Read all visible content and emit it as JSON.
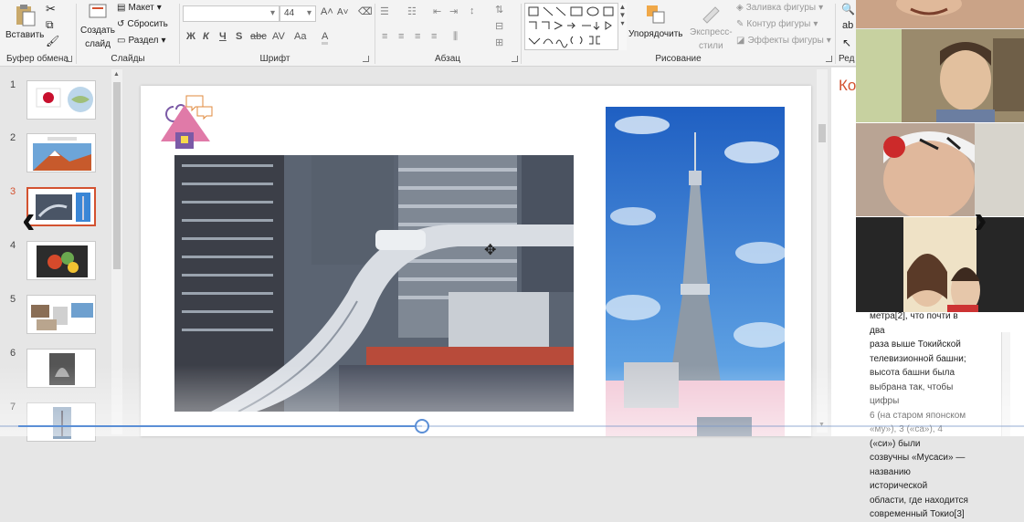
{
  "ribbon": {
    "clipboard": {
      "paste": "Вставить",
      "group": "Буфер обмена"
    },
    "slides": {
      "new_slide_1": "Создать",
      "new_slide_2": "слайд",
      "layout": "Макет",
      "reset": "Сбросить",
      "section": "Раздел",
      "group": "Слайды"
    },
    "font": {
      "size": "44",
      "group": "Шрифт",
      "bold": "Ж",
      "italic": "К",
      "underline": "Ч",
      "shadow": "S",
      "strike": "abc",
      "spacing": "AV",
      "case": "Aa",
      "color": "A"
    },
    "paragraph": {
      "group": "Абзац"
    },
    "drawing": {
      "arrange": "Упорядочить",
      "quick_styles_1": "Экспресс-",
      "quick_styles_2": "стили",
      "fill": "Заливка фигуры",
      "outline": "Контур фигуры",
      "effects": "Эффекты фигуры",
      "group": "Рисование"
    },
    "editing": {
      "group": "Ред"
    }
  },
  "slides_panel": {
    "numbers": [
      "1",
      "2",
      "3",
      "4",
      "5",
      "6",
      "7"
    ],
    "active": "3"
  },
  "notes": {
    "heading": "Ко",
    "text_lines": [
      "метра[2], что почти в два",
      "раза выше Токийской",
      "телевизионной башни;",
      "высота башни была",
      "выбрана так, чтобы цифры",
      "6 (на старом японском",
      "«му»), 3 («са»), 4 («си») были",
      "созвучны «Мусаси» —",
      "названию исторической",
      "области, где находится",
      "современный Токио[3]"
    ]
  },
  "colors": {
    "accent": "#d35230",
    "progress": "#5b8fd6"
  }
}
